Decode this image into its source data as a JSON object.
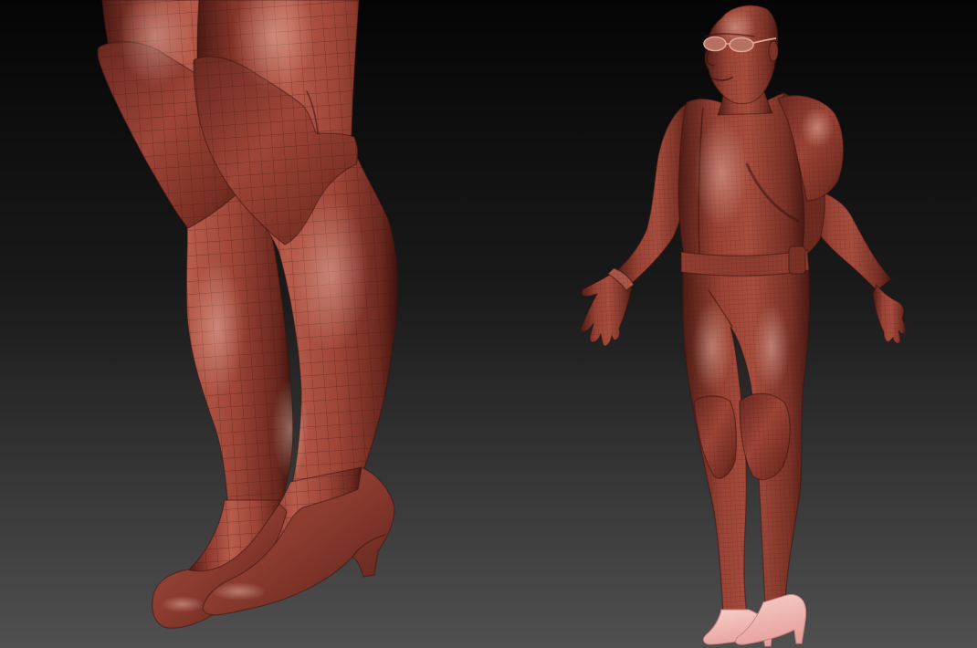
{
  "colors": {
    "background_top": "#050505",
    "background_mid": "#1a1a1a",
    "background_bottom": "#505050",
    "clay_shadow": "#4a1a14",
    "clay_base": "#9e4538",
    "clay_highlight": "#b85c4c",
    "shoe_pink": "#e8a29e",
    "shoe_pink_highlight": "#f7cfca"
  }
}
